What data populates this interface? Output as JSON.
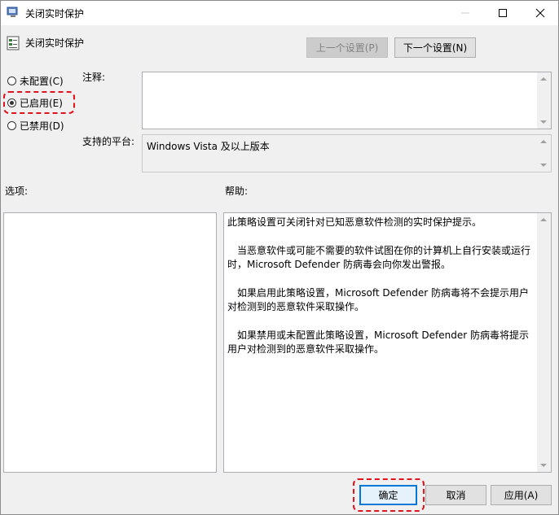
{
  "window": {
    "title": "关闭实时保护",
    "minimize_icon": "minimize-icon",
    "maximize_icon": "maximize-icon",
    "close_icon": "close-icon"
  },
  "header": {
    "policy_name": "关闭实时保护",
    "prev_button": "上一个设置(P)",
    "next_button": "下一个设置(N)"
  },
  "state": {
    "options": [
      {
        "label": "未配置(C)",
        "checked": false
      },
      {
        "label": "已启用(E)",
        "checked": true
      },
      {
        "label": "已禁用(D)",
        "checked": false
      }
    ]
  },
  "comment": {
    "label": "注释:",
    "value": ""
  },
  "platform": {
    "label": "支持的平台:",
    "value": "Windows Vista 及以上版本"
  },
  "options_section": {
    "label": "选项:"
  },
  "help_section": {
    "label": "帮助:",
    "paragraphs": [
      "此策略设置可关闭针对已知恶意软件检测的实时保护提示。",
      "　当恶意软件或可能不需要的软件试图在你的计算机上自行安装或运行时，Microsoft Defender 防病毒会向你发出警报。",
      "　如果启用此策略设置，Microsoft Defender 防病毒将不会提示用户对检测到的恶意软件采取操作。",
      "　如果禁用或未配置此策略设置，Microsoft Defender 防病毒将提示用户对检测到的恶意软件采取操作。"
    ]
  },
  "footer": {
    "ok": "确定",
    "cancel": "取消",
    "apply": "应用(A)"
  },
  "colors": {
    "highlight": "#e0141e",
    "accent": "#0078d7"
  }
}
